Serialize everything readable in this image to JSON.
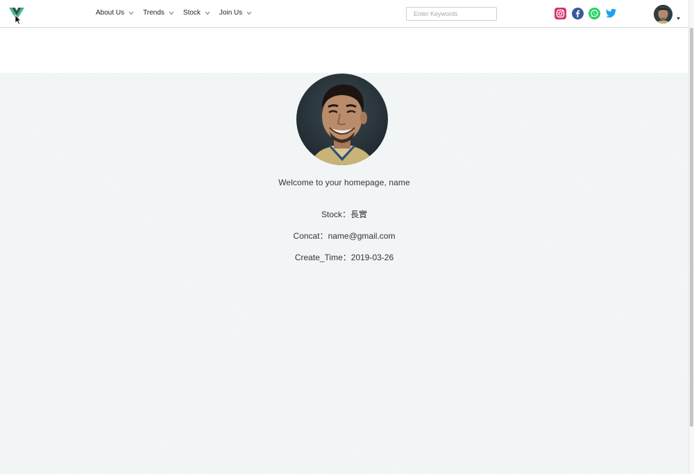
{
  "nav": {
    "menu": [
      {
        "label": "About Us"
      },
      {
        "label": "Trends"
      },
      {
        "label": "Stock"
      },
      {
        "label": "Join Us"
      }
    ],
    "search": {
      "placeholder": "Enter Keywords",
      "value": ""
    },
    "social_icons": [
      "instagram-icon",
      "facebook-icon",
      "whatsapp-icon",
      "twitter-icon"
    ]
  },
  "profile": {
    "welcome": "Welcome to your homepage, name",
    "stock_label": "Stock：",
    "stock_value": "長實",
    "contact_label": "Concat：",
    "contact_value": "name@gmail.com",
    "created_label": "Create_Time：",
    "created_value": "2019-03-26"
  },
  "colors": {
    "brand_green": "#41b883",
    "brand_dark": "#35495e",
    "instagram": "#d6336c",
    "facebook": "#3b5998",
    "whatsapp": "#25d366",
    "twitter": "#1da1f2"
  }
}
